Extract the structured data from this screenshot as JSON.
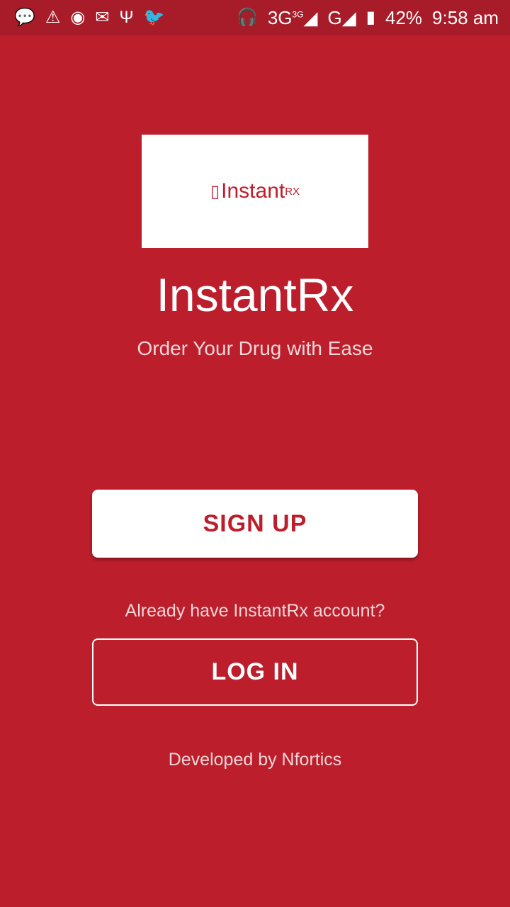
{
  "status_bar": {
    "icons": [
      "chat-icon",
      "warning-icon",
      "messenger-icon",
      "gmail-icon",
      "usb-icon",
      "twitter-icon",
      "headset-icon"
    ],
    "network1": "3G",
    "network1_sup": "3G",
    "network2": "G",
    "battery": "42%",
    "time": "9:58 am"
  },
  "logo": {
    "text": "Instant",
    "superscript": "RX"
  },
  "app_title": "InstantRx",
  "tagline": "Order Your Drug with Ease",
  "signup_label": "SIGN UP",
  "already_text": "Already have InstantRx account?",
  "login_label": "LOG IN",
  "developer_text": "Developed by Nfortics",
  "colors": {
    "background": "#bc1e2c",
    "status_bar": "#a81b28"
  }
}
